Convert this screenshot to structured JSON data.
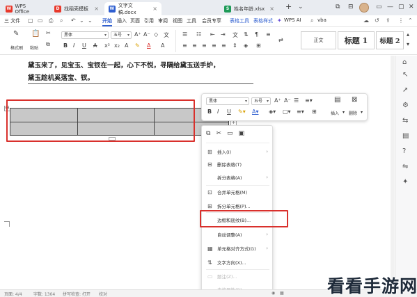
{
  "colors": {
    "accent": "#2f5fd0",
    "highlight_border": "#d9302c",
    "table_fill": "#c8c8c8"
  },
  "titlebar": {
    "tabs": [
      {
        "label": "WPS Office",
        "logo": "W",
        "logo_color": "#e8382b"
      },
      {
        "label": "找稻壳模板",
        "logo": "D",
        "logo_color": "#e8382b"
      },
      {
        "label": "文字文稿.docx",
        "logo": "W",
        "logo_color": "#2f5fd0"
      },
      {
        "label": "姓名年龄.xlsx",
        "logo": "S",
        "logo_color": "#1d9a57"
      }
    ],
    "new_tab": "+",
    "tab_menu": "⌄",
    "window_controls": [
      "⧉",
      "⊟",
      "▭",
      "—",
      "▢",
      "✕"
    ]
  },
  "menubar": {
    "file": "三 文件",
    "items": [
      "开始",
      "插入",
      "页面",
      "引用",
      "审阅",
      "视图",
      "工具",
      "会员专享",
      "表格工具",
      "表格样式"
    ],
    "active": "开始",
    "wps_ai": "WPS AI",
    "search": "vba"
  },
  "ribbon": {
    "format_painter": "格式刷",
    "paste": "粘贴",
    "font_name": "黑体",
    "font_size": "五号",
    "style_normal": "正文",
    "style_h1": "标题 1",
    "style_h2": "标题 2"
  },
  "document": {
    "line1": "黛玉来了，见宝玉、宝钗在一起，心下不悦，寻隔给黛玉送手炉，",
    "line2": "黛玉趁机奚落宝、钗。"
  },
  "float_toolbar": {
    "font_name": "黑体",
    "font_size": "五号",
    "insert_label": "插入",
    "delete_label": "删除"
  },
  "context_menu": {
    "items": [
      {
        "icon": "⊞",
        "label": "插入(I)",
        "arrow": "›",
        "disabled": false
      },
      {
        "icon": "⊟",
        "label": "删除表格(T)",
        "arrow": "",
        "disabled": false
      },
      {
        "icon": "",
        "label": "拆分表格(A)",
        "arrow": "›",
        "disabled": false
      },
      {
        "icon": "⊡",
        "label": "合并单元格(M)",
        "arrow": "",
        "disabled": false
      },
      {
        "icon": "⊞",
        "label": "拆分单元格(P)...",
        "arrow": "",
        "disabled": false
      },
      {
        "icon": "",
        "label": "边框和底纹(B)...",
        "arrow": "",
        "disabled": false
      },
      {
        "icon": "",
        "label": "自动调整(A)",
        "arrow": "›",
        "disabled": false
      },
      {
        "icon": "▦",
        "label": "单元格对齐方式(G)",
        "arrow": "›",
        "disabled": false
      },
      {
        "icon": "⇅",
        "label": "文字方向(X)...",
        "arrow": "",
        "disabled": false
      },
      {
        "icon": "▭",
        "label": "题注(Z)...",
        "arrow": "",
        "disabled": true
      },
      {
        "icon": "",
        "label": "表格属性(R)...",
        "arrow": "",
        "disabled": true
      }
    ]
  },
  "statusbar": {
    "page": "页面: 4/4",
    "words": "字数: 1304",
    "spell": "拼写检查: 打开",
    "proof": "校对"
  },
  "watermark": "看看手游网"
}
